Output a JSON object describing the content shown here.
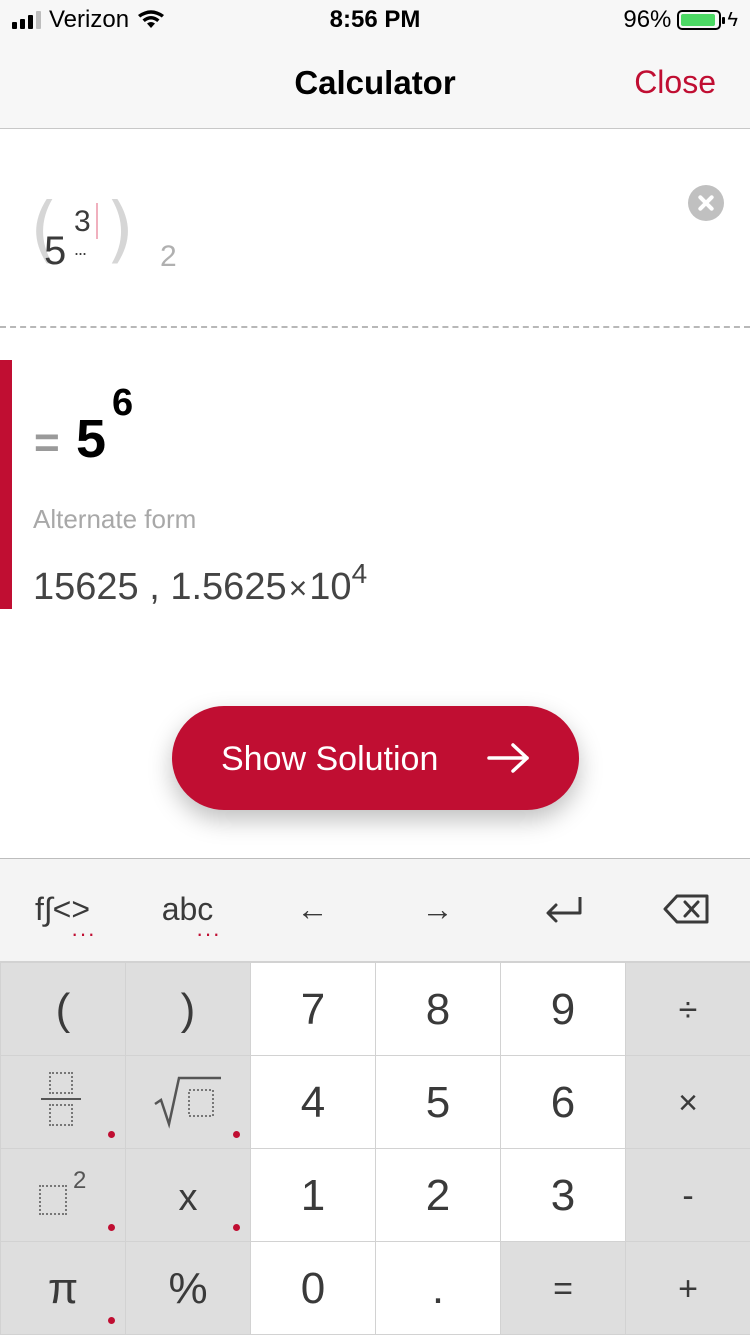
{
  "status_bar": {
    "carrier": "Verizon",
    "time": "8:56 PM",
    "battery_percent": "96%",
    "signal_bars_filled": 3,
    "signal_bars_total": 4,
    "battery_level": 0.96
  },
  "nav": {
    "title": "Calculator",
    "close_label": "Close"
  },
  "input": {
    "base": "5",
    "inner_exponent": "3",
    "inner_placeholder": "...",
    "outer_exponent": "2"
  },
  "result": {
    "equals": "=",
    "base": "5",
    "exponent": "6",
    "alternate_label": "Alternate form",
    "alternate_value_1": "15625",
    "separator": ",",
    "alternate_value_2_mantissa": "1.5625",
    "times": "×",
    "alternate_value_2_base": "10",
    "alternate_value_2_exponent": "4"
  },
  "show_solution": {
    "label": "Show Solution"
  },
  "keyboard": {
    "top_row": [
      {
        "label": "f∫<>",
        "dots": "···"
      },
      {
        "label": "abc",
        "dots": "···"
      },
      {
        "label": "←"
      },
      {
        "label": "→"
      },
      {
        "icon": "return-icon"
      },
      {
        "icon": "backspace-icon"
      }
    ],
    "rows": [
      [
        "(",
        ")",
        "7",
        "8",
        "9",
        "÷"
      ],
      [
        "fraction",
        "sqrt",
        "4",
        "5",
        "6",
        "×"
      ],
      [
        "square",
        "x",
        "1",
        "2",
        "3",
        "-"
      ],
      [
        "π",
        "%",
        "0",
        ".",
        "=",
        "+"
      ]
    ],
    "labels": {
      "lparen": "(",
      "rparen": ")",
      "seven": "7",
      "eight": "8",
      "nine": "9",
      "divide": "÷",
      "four": "4",
      "five": "5",
      "six": "6",
      "multiply": "×",
      "square_exp": "2",
      "x": "x",
      "one": "1",
      "two": "2",
      "three": "3",
      "minus": "-",
      "pi": "π",
      "percent": "%",
      "zero": "0",
      "dot": ".",
      "equals": "=",
      "plus": "+"
    }
  },
  "colors": {
    "accent": "#c00e32",
    "battery": "#4cd964",
    "key_gray": "#dedede",
    "key_white": "#ffffff"
  }
}
